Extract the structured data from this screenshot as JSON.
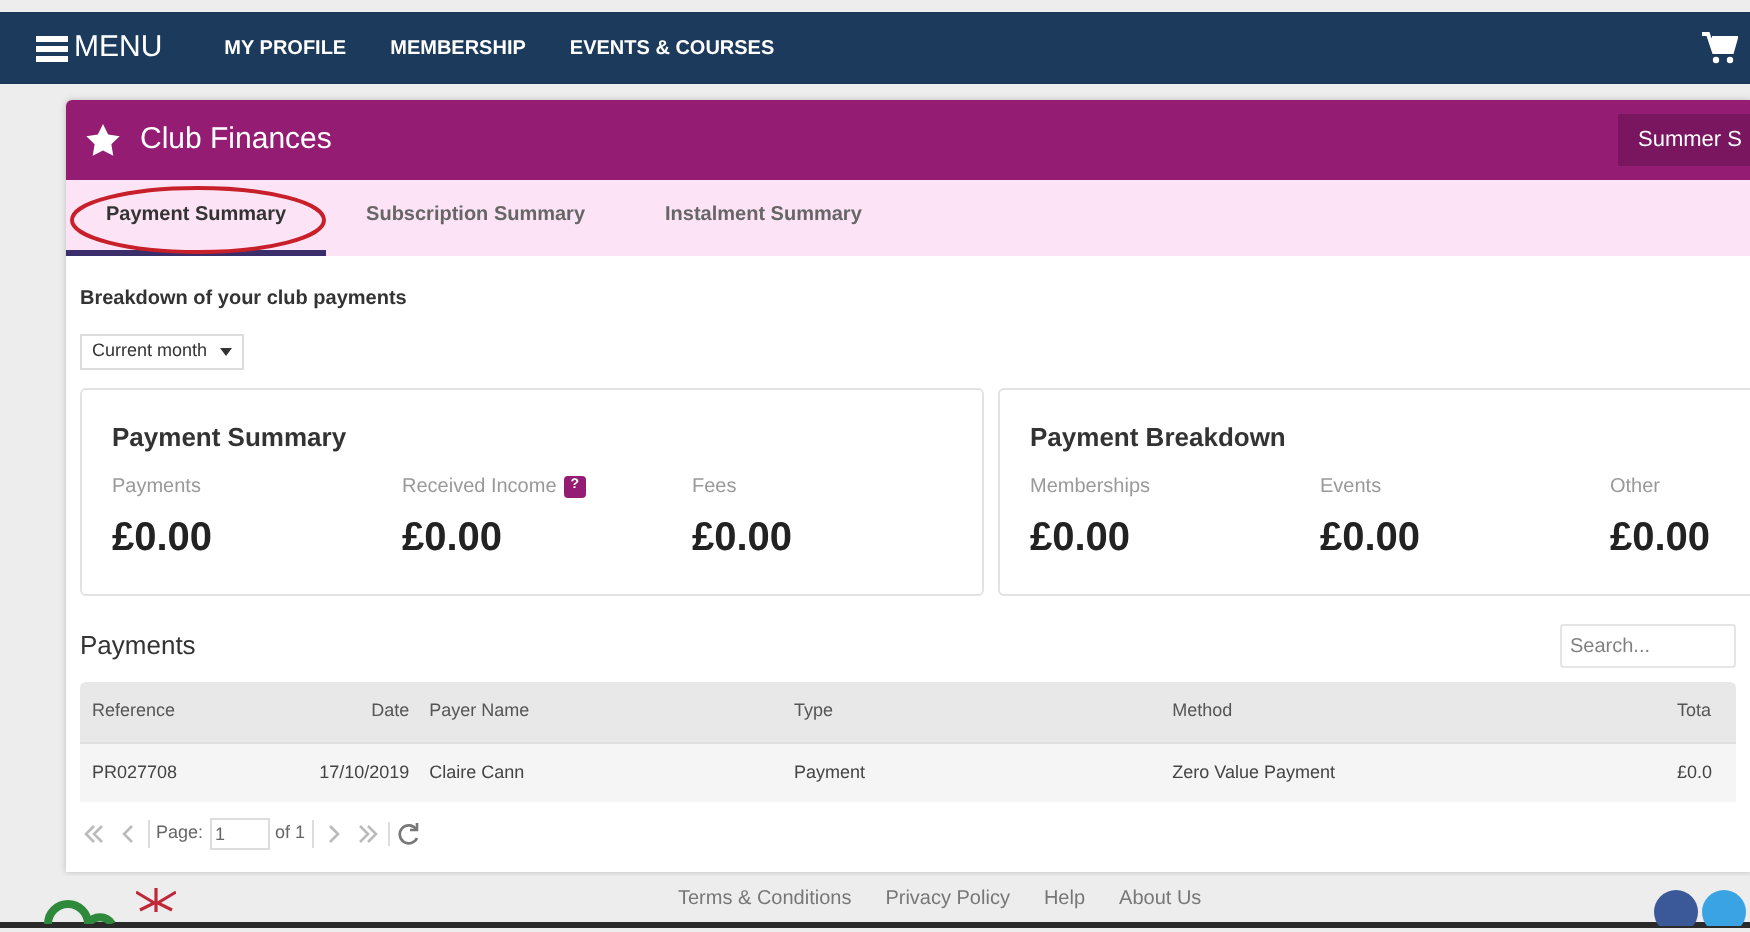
{
  "nav": {
    "menu_label": "MENU",
    "links": [
      "MY PROFILE",
      "MEMBERSHIP",
      "EVENTS & COURSES"
    ]
  },
  "panel": {
    "title": "Club Finances",
    "season_button": "Summer S",
    "tabs": [
      {
        "label": "Payment Summary",
        "selected": true
      },
      {
        "label": "Subscription Summary",
        "selected": false
      },
      {
        "label": "Instalment Summary",
        "selected": false
      }
    ],
    "intro": "Breakdown of your club payments",
    "period_select": "Current month",
    "summary_cards": [
      {
        "title": "Payment Summary",
        "stats": [
          {
            "label": "Payments",
            "value": "£0.00"
          },
          {
            "label": "Received Income",
            "value": "£0.00",
            "help_badge": "?"
          },
          {
            "label": "Fees",
            "value": "£0.00"
          }
        ]
      },
      {
        "title": "Payment Breakdown",
        "stats": [
          {
            "label": "Memberships",
            "value": "£0.00"
          },
          {
            "label": "Events",
            "value": "£0.00"
          },
          {
            "label": "Other",
            "value": "£0.00"
          }
        ]
      }
    ],
    "payments": {
      "title": "Payments",
      "search_placeholder": "Search...",
      "columns": [
        "Reference",
        "Date",
        "Payer Name",
        "Type",
        "Method",
        "Tota"
      ],
      "rows": [
        [
          "PR027708",
          "17/10/2019",
          "Claire Cann",
          "Payment",
          "Zero Value Payment",
          "£0.0"
        ]
      ],
      "pager": {
        "page_label": "Page:",
        "page": "1",
        "of_label": "of 1"
      }
    }
  },
  "footer": {
    "links": [
      "Terms & Conditions",
      "Privacy Policy",
      "Help",
      "About Us"
    ]
  }
}
